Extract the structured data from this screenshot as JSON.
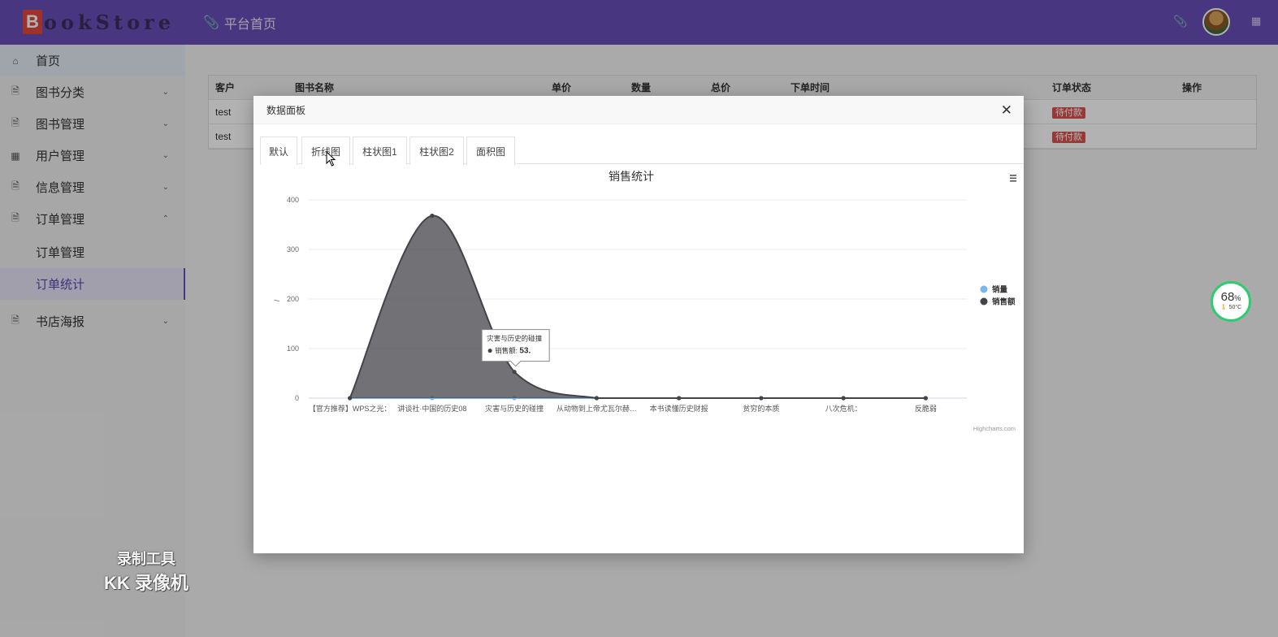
{
  "header": {
    "logo_letter": "B",
    "logo_text": "ookStore",
    "breadcrumb": "平台首页"
  },
  "sidebar": {
    "items": [
      {
        "label": "首页",
        "icon": "home-icon"
      },
      {
        "label": "图书分类",
        "icon": "document-icon"
      },
      {
        "label": "图书管理",
        "icon": "document-icon"
      },
      {
        "label": "用户管理",
        "icon": "grid-icon"
      },
      {
        "label": "信息管理",
        "icon": "document-icon"
      },
      {
        "label": "订单管理",
        "icon": "document-icon"
      },
      {
        "label": "书店海报",
        "icon": "document-icon"
      }
    ],
    "sub_items": [
      "订单管理",
      "订单统计"
    ]
  },
  "table": {
    "headers": [
      "客户",
      "图书名称",
      "单价",
      "数量",
      "总价",
      "下单时间",
      "订单状态",
      "操作"
    ],
    "rows": [
      {
        "customer": "test",
        "status": "待付款"
      },
      {
        "customer": "test",
        "status": "待付款"
      }
    ]
  },
  "dialog": {
    "title": "数据面板",
    "tabs": [
      "默认",
      "折线图",
      "柱状图1",
      "柱状图2",
      "面积图"
    ],
    "active_tab": "默认"
  },
  "chart_data": {
    "type": "area",
    "title": "销售统计",
    "ylabel": "/",
    "xlabel": "",
    "ylim": [
      0,
      400
    ],
    "yticks": [
      0,
      100,
      200,
      300,
      400
    ],
    "categories": [
      "【官方推荐】WPS之光：",
      "讲谈社·中国的历史08",
      "灾害与历史的碰撞",
      "从动物到上帝尤瓦尔赫…",
      "本书读懂历史财报",
      "贫穷的本质",
      "八次危机：",
      "反脆弱"
    ],
    "series": [
      {
        "name": "销量",
        "color": "#7cb5ec",
        "values": [
          0,
          0,
          0,
          0,
          0,
          0,
          0,
          0
        ]
      },
      {
        "name": "销售额",
        "color": "#434348",
        "values": [
          0,
          368,
          53,
          0,
          0,
          0,
          0,
          0
        ]
      }
    ],
    "legend_position": "right",
    "tooltip": {
      "category": "灾害与历史的碰撞",
      "series": "销售额",
      "value": "53."
    },
    "credits": "Highcharts.com"
  },
  "widgets": {
    "gauge_percent": "68",
    "gauge_percent_unit": "%",
    "gauge_temp": "50°C"
  },
  "watermark": {
    "line1": "录制工具",
    "line2": "KK 录像机"
  }
}
